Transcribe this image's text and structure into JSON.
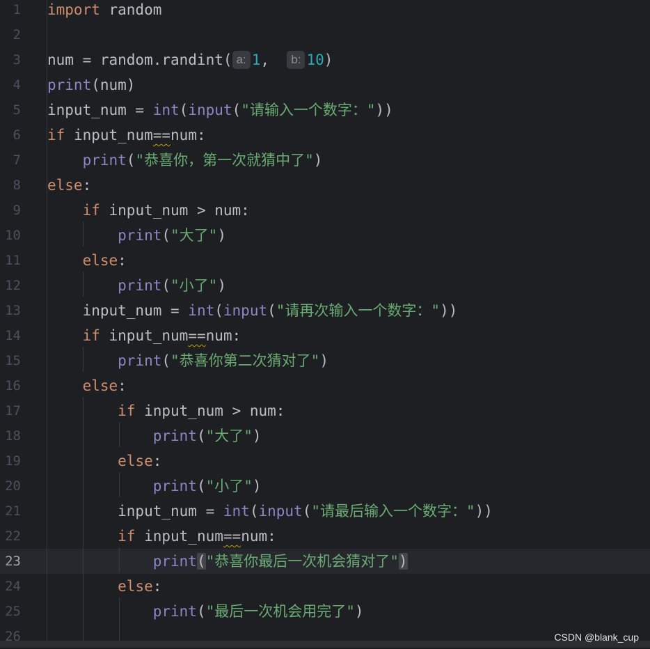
{
  "editor": {
    "lines": [
      {
        "n": "1",
        "tokens": [
          {
            "t": "import",
            "c": "kw"
          },
          {
            "t": " random"
          }
        ]
      },
      {
        "n": "2",
        "tokens": []
      },
      {
        "n": "3",
        "tokens": [
          {
            "t": "num = random.randint("
          },
          {
            "t": "a:",
            "c": "hint"
          },
          {
            "t": "1",
            "c": "num"
          },
          {
            "t": ",  "
          },
          {
            "t": "b:",
            "c": "hint"
          },
          {
            "t": "10",
            "c": "num"
          },
          {
            "t": ")"
          }
        ]
      },
      {
        "n": "4",
        "tokens": [
          {
            "t": "print",
            "c": "bi"
          },
          {
            "t": "(num)"
          }
        ]
      },
      {
        "n": "5",
        "tokens": [
          {
            "t": "input_num = "
          },
          {
            "t": "int",
            "c": "bi"
          },
          {
            "t": "("
          },
          {
            "t": "input",
            "c": "bi"
          },
          {
            "t": "("
          },
          {
            "t": "\"请输入一个数字：\"",
            "c": "str"
          },
          {
            "t": "))"
          }
        ]
      },
      {
        "n": "6",
        "tokens": [
          {
            "t": "if",
            "c": "kw"
          },
          {
            "t": " input_num"
          },
          {
            "t": "==",
            "c": "wavy"
          },
          {
            "t": "num:"
          }
        ]
      },
      {
        "n": "7",
        "tokens": [
          {
            "t": "    "
          },
          {
            "t": "print",
            "c": "bi"
          },
          {
            "t": "("
          },
          {
            "t": "\"恭喜你，第一次就猜中了\"",
            "c": "str"
          },
          {
            "t": ")"
          }
        ]
      },
      {
        "n": "8",
        "tokens": [
          {
            "t": "else",
            "c": "kw"
          },
          {
            "t": ":"
          }
        ]
      },
      {
        "n": "9",
        "tokens": [
          {
            "t": "    "
          },
          {
            "t": "if",
            "c": "kw"
          },
          {
            "t": " input_num > num:"
          }
        ]
      },
      {
        "n": "10",
        "tokens": [
          {
            "t": "        "
          },
          {
            "t": "print",
            "c": "bi"
          },
          {
            "t": "("
          },
          {
            "t": "\"大了\"",
            "c": "str"
          },
          {
            "t": ")"
          }
        ]
      },
      {
        "n": "11",
        "tokens": [
          {
            "t": "    "
          },
          {
            "t": "else",
            "c": "kw"
          },
          {
            "t": ":"
          }
        ]
      },
      {
        "n": "12",
        "tokens": [
          {
            "t": "        "
          },
          {
            "t": "print",
            "c": "bi"
          },
          {
            "t": "("
          },
          {
            "t": "\"小了\"",
            "c": "str"
          },
          {
            "t": ")"
          }
        ]
      },
      {
        "n": "13",
        "tokens": [
          {
            "t": "    input_num = "
          },
          {
            "t": "int",
            "c": "bi"
          },
          {
            "t": "("
          },
          {
            "t": "input",
            "c": "bi"
          },
          {
            "t": "("
          },
          {
            "t": "\"请再次输入一个数字：\"",
            "c": "str"
          },
          {
            "t": "))"
          }
        ]
      },
      {
        "n": "14",
        "tokens": [
          {
            "t": "    "
          },
          {
            "t": "if",
            "c": "kw"
          },
          {
            "t": " input_num"
          },
          {
            "t": "==",
            "c": "wavy"
          },
          {
            "t": "num:"
          }
        ]
      },
      {
        "n": "15",
        "tokens": [
          {
            "t": "        "
          },
          {
            "t": "print",
            "c": "bi"
          },
          {
            "t": "("
          },
          {
            "t": "\"恭喜你第二次猜对了\"",
            "c": "str"
          },
          {
            "t": ")"
          }
        ]
      },
      {
        "n": "16",
        "tokens": [
          {
            "t": "    "
          },
          {
            "t": "else",
            "c": "kw"
          },
          {
            "t": ":"
          }
        ]
      },
      {
        "n": "17",
        "tokens": [
          {
            "t": "        "
          },
          {
            "t": "if",
            "c": "kw"
          },
          {
            "t": " input_num > num:"
          }
        ]
      },
      {
        "n": "18",
        "tokens": [
          {
            "t": "            "
          },
          {
            "t": "print",
            "c": "bi"
          },
          {
            "t": "("
          },
          {
            "t": "\"大了\"",
            "c": "str"
          },
          {
            "t": ")"
          }
        ]
      },
      {
        "n": "19",
        "tokens": [
          {
            "t": "        "
          },
          {
            "t": "else",
            "c": "kw"
          },
          {
            "t": ":"
          }
        ]
      },
      {
        "n": "20",
        "tokens": [
          {
            "t": "            "
          },
          {
            "t": "print",
            "c": "bi"
          },
          {
            "t": "("
          },
          {
            "t": "\"小了\"",
            "c": "str"
          },
          {
            "t": ")"
          }
        ]
      },
      {
        "n": "21",
        "tokens": [
          {
            "t": "        input_num = "
          },
          {
            "t": "int",
            "c": "bi"
          },
          {
            "t": "("
          },
          {
            "t": "input",
            "c": "bi"
          },
          {
            "t": "("
          },
          {
            "t": "\"请最后输入一个数字：\"",
            "c": "str"
          },
          {
            "t": "))"
          }
        ]
      },
      {
        "n": "22",
        "tokens": [
          {
            "t": "        "
          },
          {
            "t": "if",
            "c": "kw"
          },
          {
            "t": " input_num"
          },
          {
            "t": "==",
            "c": "wavy"
          },
          {
            "t": "num:"
          }
        ]
      },
      {
        "n": "23",
        "current": true,
        "tokens": [
          {
            "t": "            "
          },
          {
            "t": "print",
            "c": "bi"
          },
          {
            "t": "(",
            "c": "brace-hl"
          },
          {
            "t": "\"恭喜你最后一次机会猜对了\"",
            "c": "str"
          },
          {
            "t": ")",
            "c": "brace-hl"
          }
        ]
      },
      {
        "n": "24",
        "tokens": [
          {
            "t": "        "
          },
          {
            "t": "else",
            "c": "kw"
          },
          {
            "t": ":"
          }
        ]
      },
      {
        "n": "25",
        "tokens": [
          {
            "t": "            "
          },
          {
            "t": "print",
            "c": "bi"
          },
          {
            "t": "("
          },
          {
            "t": "\"最后一次机会用完了\"",
            "c": "str"
          },
          {
            "t": ")"
          }
        ]
      },
      {
        "n": "26",
        "tokens": []
      }
    ]
  },
  "watermark": "CSDN @blank_cup"
}
